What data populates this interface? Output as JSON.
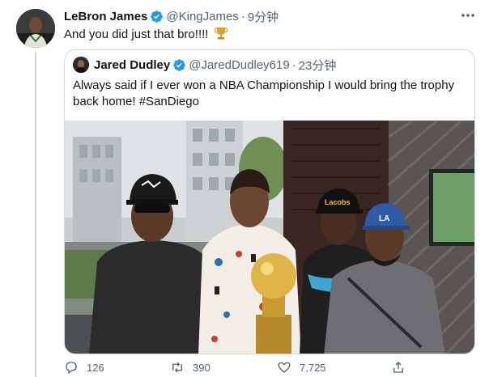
{
  "tweet": {
    "name": "LeBron James",
    "handle": "@KingJames",
    "separator": "·",
    "time": "9分钟",
    "text": "And you did just that bro!!!!",
    "emoji": "trophy-icon"
  },
  "quote": {
    "name": "Jared Dudley",
    "handle": "@JaredDudley619",
    "separator": "·",
    "time": "23分钟",
    "text": "Always said if I ever won a NBA Championship I would bring the trophy back home! ",
    "hashtag": "#SanDiego",
    "cap_logo_text": "Lacobs"
  },
  "actions": {
    "reply_count": "126",
    "retweet_count": "390",
    "like_count": "7,725"
  },
  "colors": {
    "verified": "#1d9bf0",
    "secondary_text": "#536471",
    "border": "#cfd9de",
    "trophy_gold": "#d4a72c"
  }
}
